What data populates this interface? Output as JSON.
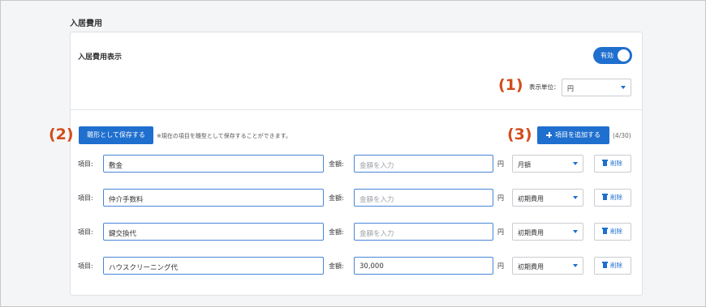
{
  "section": {
    "title": "入居費用"
  },
  "card": {
    "header_label": "入居費用表示",
    "toggle_label": "有効",
    "unit_label": "表示単位：",
    "unit_value": "円"
  },
  "annotations": {
    "one": "(1)",
    "two": "(2)",
    "three": "(3)"
  },
  "toolbar": {
    "save_template_label": "雛形として保存する",
    "note": "※現在の項目を雛型として保存することができます。",
    "add_item_label": "項目を追加する",
    "count": "(4/30)"
  },
  "rows": [
    {
      "item_label": "項目:",
      "item_value": "敷金",
      "amount_label": "金額:",
      "amount_value": "",
      "amount_placeholder": "金額を入力",
      "yen": "円",
      "type": "月額",
      "delete_label": "削除"
    },
    {
      "item_label": "項目:",
      "item_value": "仲介手数料",
      "amount_label": "金額:",
      "amount_value": "",
      "amount_placeholder": "金額を入力",
      "yen": "円",
      "type": "初期費用",
      "delete_label": "削除"
    },
    {
      "item_label": "項目:",
      "item_value": "鍵交換代",
      "amount_label": "金額:",
      "amount_value": "",
      "amount_placeholder": "金額を入力",
      "yen": "円",
      "type": "初期費用",
      "delete_label": "削除"
    },
    {
      "item_label": "項目:",
      "item_value": "ハウスクリーニング代",
      "amount_label": "金額:",
      "amount_value": "30,000",
      "amount_placeholder": "金額を入力",
      "yen": "円",
      "type": "初期費用",
      "delete_label": "削除"
    }
  ],
  "colors": {
    "accent": "#1f6fcf",
    "annotation": "#d24c1b"
  }
}
